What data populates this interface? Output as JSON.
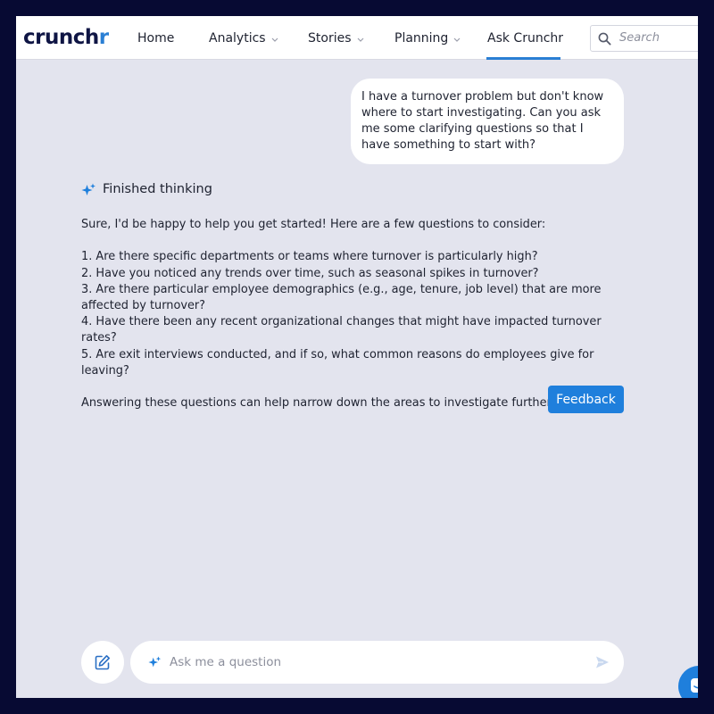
{
  "header": {
    "logo": {
      "part1": "c",
      "part2": "runch",
      "part3": "r"
    },
    "nav": [
      {
        "label": "Home",
        "dropdown": false
      },
      {
        "label": "Analytics",
        "dropdown": true
      },
      {
        "label": "Stories",
        "dropdown": true
      },
      {
        "label": "Planning",
        "dropdown": true
      },
      {
        "label": "Ask Crunchr",
        "dropdown": false,
        "active": true
      }
    ],
    "search": {
      "placeholder": "Search"
    }
  },
  "conversation": {
    "user_message": "I have a turnover problem but don't know where to start investigating. Can you ask me some clarifying questions so that I have something to start with?",
    "status": "Finished thinking",
    "answer": {
      "intro": "Sure, I'd be happy to help you get started! Here are a few questions to consider:",
      "questions": [
        "1. Are there specific departments or teams where turnover is particularly high?",
        "2. Have you noticed any trends over time, such as seasonal spikes in turnover?",
        "3. Are there particular employee demographics (e.g., age, tenure, job level) that are more affected by turnover?",
        "4. Have there been any recent organizational changes that might have impacted turnover rates?",
        "5. Are exit interviews conducted, and if so, what common reasons do employees give for leaving?"
      ],
      "closing": "Answering these questions can help narrow down the areas to investigate further."
    },
    "feedback_label": "Feedback"
  },
  "composer": {
    "placeholder": "Ask me a question"
  },
  "colors": {
    "accent": "#1f7fdc",
    "brand_dark": "#0f1544",
    "page_background": "#e3e4ee",
    "outer_background": "#070a33"
  },
  "icons": {
    "search": "search-icon",
    "sparkle": "sparkle-icon",
    "edit": "edit-icon",
    "send": "send-icon",
    "chat": "chat-icon",
    "chevron": "chevron-down-icon"
  }
}
